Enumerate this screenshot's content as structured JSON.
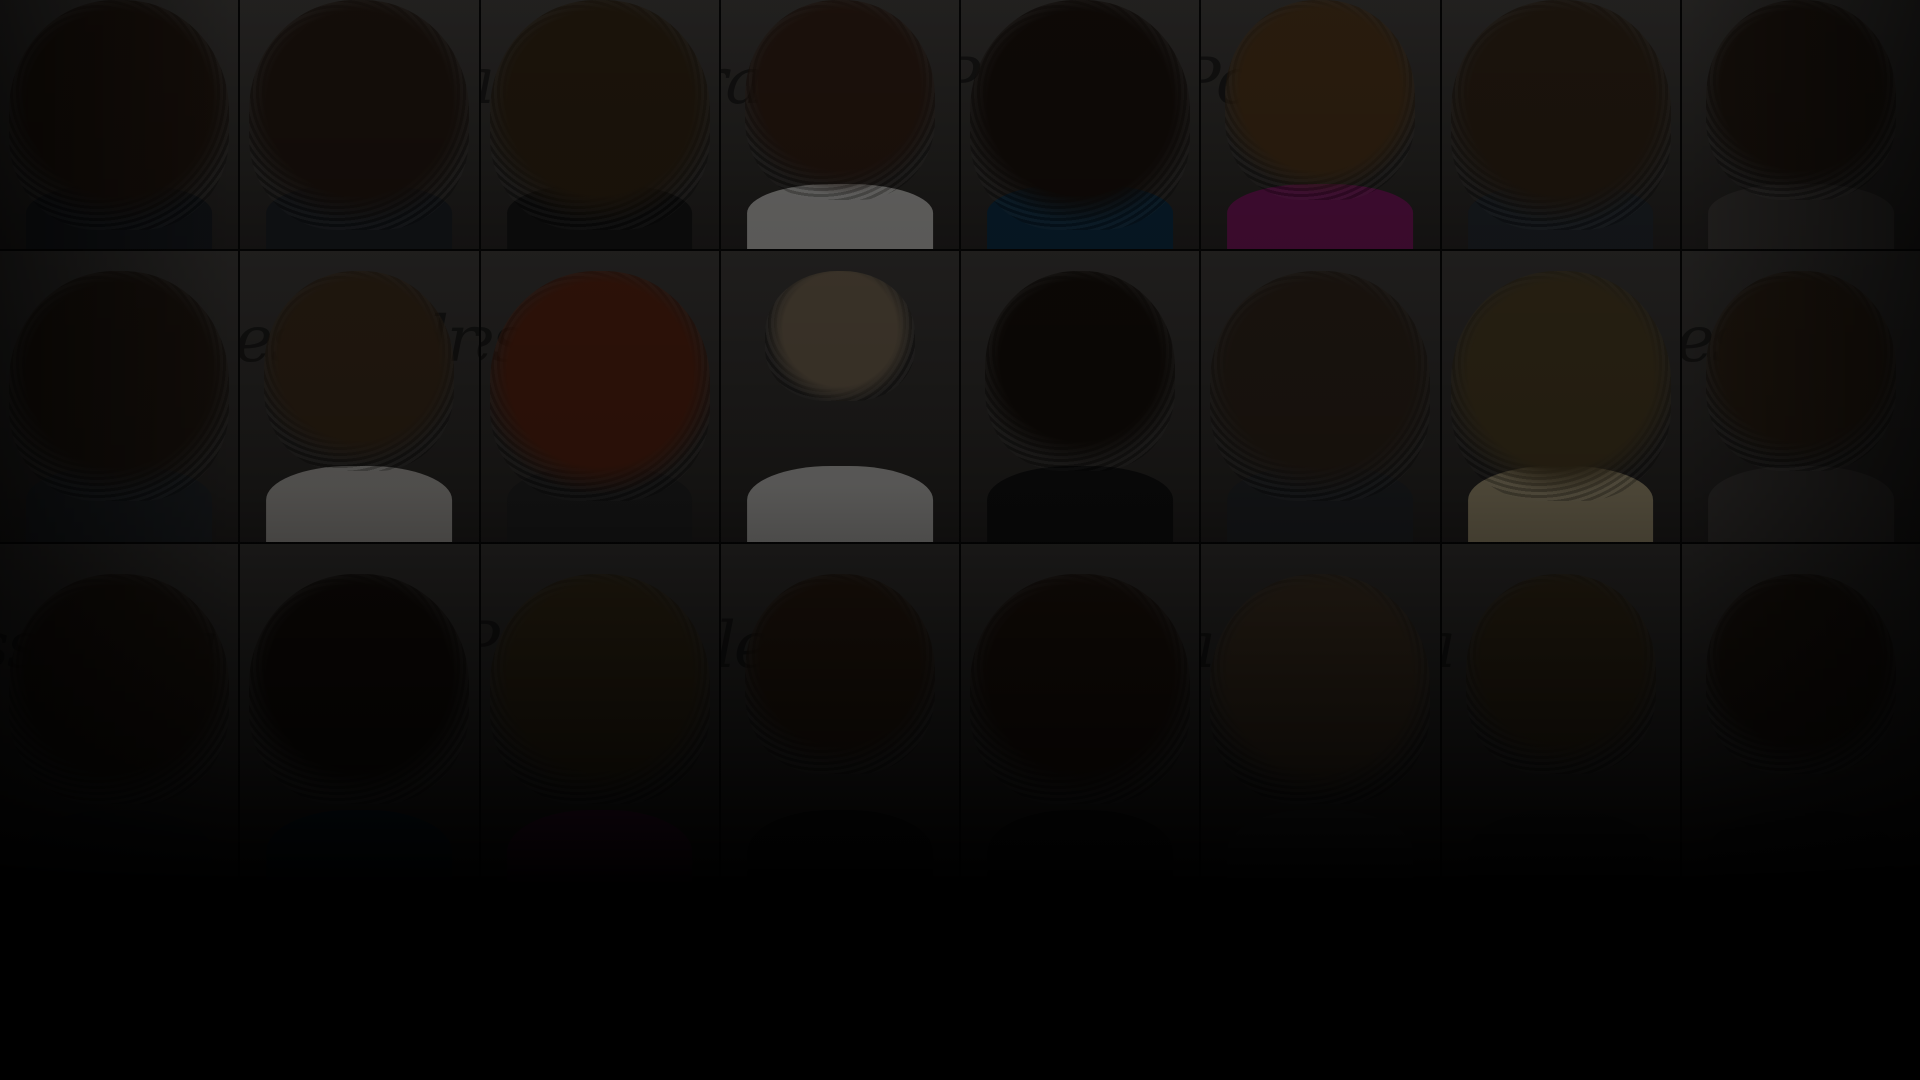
{
  "background_color": "#000000",
  "mosaic": {
    "wall_color": "#3e3b38",
    "tiles": [
      {
        "hair": "#2a1c12",
        "shirt": "#1e2228",
        "script": "",
        "hair_size": "large"
      },
      {
        "hair": "#2b1d14",
        "shirt": "#22262c",
        "script": "",
        "hair_size": "large"
      },
      {
        "hair": "#3a2a16",
        "shirt": "#1a1a1a",
        "script": "a",
        "hair_size": "large"
      },
      {
        "hair": "#3b2418",
        "shirt": "#d8d6d2",
        "script": "ra",
        "hair_size": "medium"
      },
      {
        "hair": "#1e140e",
        "shirt": "#0f3550",
        "script": "P",
        "hair_size": "large"
      },
      {
        "hair": "#5a3d1e",
        "shirt": "#8a1a6a",
        "script": "Po",
        "hair_size": "medium"
      },
      {
        "hair": "#3a2a1a",
        "shirt": "#2a3138",
        "script": "",
        "hair_size": "large"
      },
      {
        "hair": "#2a1e14",
        "shirt": "#4a4643",
        "script": "",
        "hair_size": "medium"
      },
      {
        "hair": "#2a1e14",
        "shirt": "#2a2f34",
        "script": "",
        "hair_size": "large"
      },
      {
        "hair": "#4a3520",
        "shirt": "#d0ccc6",
        "script": "lessandra",
        "hair_size": "medium"
      },
      {
        "hair": "#6a2a14",
        "shirt": "#2a2a2a",
        "script": "essan",
        "hair_size": "large"
      },
      {
        "hair": "#8a7860",
        "shirt": "#e4e2de",
        "script": "",
        "hair_size": "small"
      },
      {
        "hair": "#1a120c",
        "shirt": "#141414",
        "script": "",
        "hair_size": "medium"
      },
      {
        "hair": "#3a2c20",
        "shirt": "#2c2f33",
        "script": "",
        "hair_size": "large"
      },
      {
        "hair": "#5a4a2a",
        "shirt": "#c8b890",
        "script": "",
        "hair_size": "large"
      },
      {
        "hair": "#3a2a1a",
        "shirt": "#4a4643",
        "script": "lessa",
        "hair_size": "medium"
      },
      {
        "hair": "#2a1e14",
        "shirt": "#2a2f34",
        "script": "ssandra",
        "hair_size": "large"
      },
      {
        "hair": "#1a120c",
        "shirt": "#0f2f45",
        "script": "",
        "hair_size": "large"
      },
      {
        "hair": "#4a3a1e",
        "shirt": "#6a1a55",
        "script": "P",
        "hair_size": "large"
      },
      {
        "hair": "#3a2616",
        "shirt": "#1a1a1a",
        "script": "lless",
        "hair_size": "medium"
      },
      {
        "hair": "#2a1a10",
        "shirt": "#1c1c1c",
        "script": "",
        "hair_size": "large"
      },
      {
        "hair": "#5a4630",
        "shirt": "#3a3a3a",
        "script": "a",
        "hair_size": "large"
      },
      {
        "hair": "#4a3a20",
        "shirt": "#2a2a2a",
        "script": "a",
        "hair_size": "medium"
      },
      {
        "hair": "#2a1e14",
        "shirt": "#2a2a2a",
        "script": "",
        "hair_size": "medium"
      }
    ]
  }
}
